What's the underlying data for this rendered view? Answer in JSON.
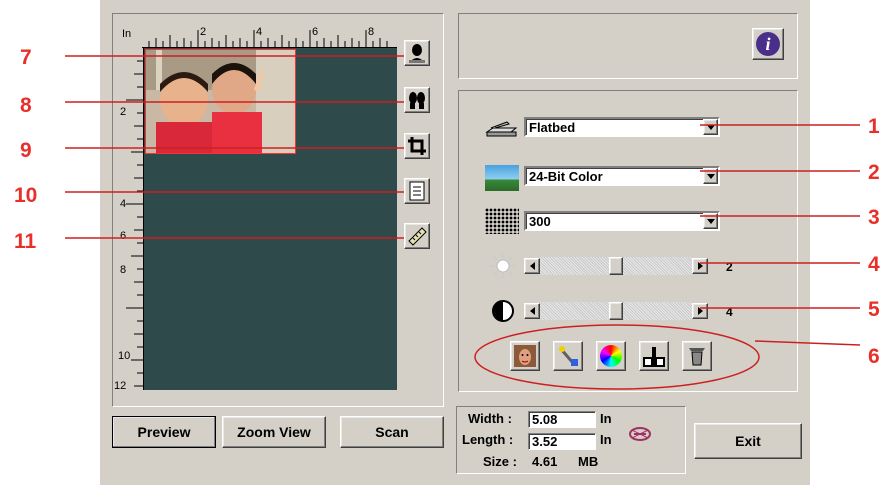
{
  "callouts_left": [
    "7",
    "8",
    "9",
    "10",
    "11"
  ],
  "callouts_right": [
    "1",
    "2",
    "3",
    "4",
    "5",
    "6"
  ],
  "ruler": {
    "unit": "In",
    "top_ticks": [
      "2",
      "4",
      "6",
      "8"
    ],
    "left_ticks": [
      "2",
      "4",
      "6",
      "8",
      "10",
      "12"
    ]
  },
  "tools": [
    "portrait-tool-icon",
    "mirror-tool-icon",
    "crop-tool-icon",
    "page-tool-icon",
    "ruler-tool-icon"
  ],
  "info_button": "i",
  "settings": {
    "scan_source": "Flatbed",
    "image_type": "24-Bit Color",
    "resolution": "300",
    "brightness_value": "2",
    "contrast_value": "4",
    "brightness_level": 0.5,
    "contrast_level": 0.5
  },
  "adjust_tools": [
    "face-tool-icon",
    "magic-wand-icon",
    "color-wheel-icon",
    "levels-icon",
    "filter-icon"
  ],
  "size_panel": {
    "width_label": "Width :",
    "width_value": "5.08",
    "width_unit": "In",
    "length_label": "Length :",
    "length_value": "3.52",
    "length_unit": "In",
    "size_label": "Size :",
    "size_value": "4.61",
    "size_unit": "MB"
  },
  "buttons": {
    "preview": "Preview",
    "zoom_view": "Zoom View",
    "scan": "Scan",
    "exit": "Exit"
  },
  "colors": {
    "window_bg": "#d4d0c8",
    "preview_bg": "#2f4a4a",
    "callout_red": "#e8302a",
    "info_purple": "#4a2f8a"
  }
}
